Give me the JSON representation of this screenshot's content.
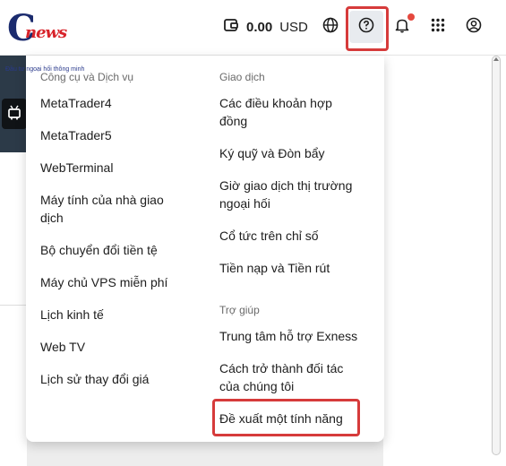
{
  "logo": {
    "brand": "news",
    "tagline": "Đầu tư ngoại hối thông minh"
  },
  "header": {
    "balance_amount": "0.00",
    "balance_currency": "USD",
    "icons": [
      "wallet-icon",
      "globe-icon",
      "help-icon",
      "bell-icon",
      "apps-grid-icon",
      "account-icon"
    ]
  },
  "menu": {
    "tools": {
      "title": "Công cụ và Dịch vụ",
      "items": [
        "MetaTrader4",
        "MetaTrader5",
        "WebTerminal",
        "Máy tính của nhà giao dịch",
        "Bộ chuyển đổi tiền tệ",
        "Máy chủ VPS miễn phí",
        "Lịch kinh tế",
        "Web TV",
        "Lịch sử thay đổi giá"
      ]
    },
    "trading": {
      "title": "Giao dịch",
      "items": [
        "Các điều khoản hợp đồng",
        "Ký quỹ và Đòn bẩy",
        "Giờ giao dịch thị trường ngoại hối",
        "Cổ tức trên chỉ số",
        "Tiền nạp và Tiền rút"
      ]
    },
    "help": {
      "title": "Trợ giúp",
      "items": [
        "Trung tâm hỗ trợ Exness",
        "Cách trở thành đối tác của chúng tôi",
        "Đề xuất một tính năng"
      ]
    }
  },
  "colors": {
    "highlight": "#d63b3b",
    "notification": "#e5483e",
    "dark_panel": "#2c3a48"
  }
}
